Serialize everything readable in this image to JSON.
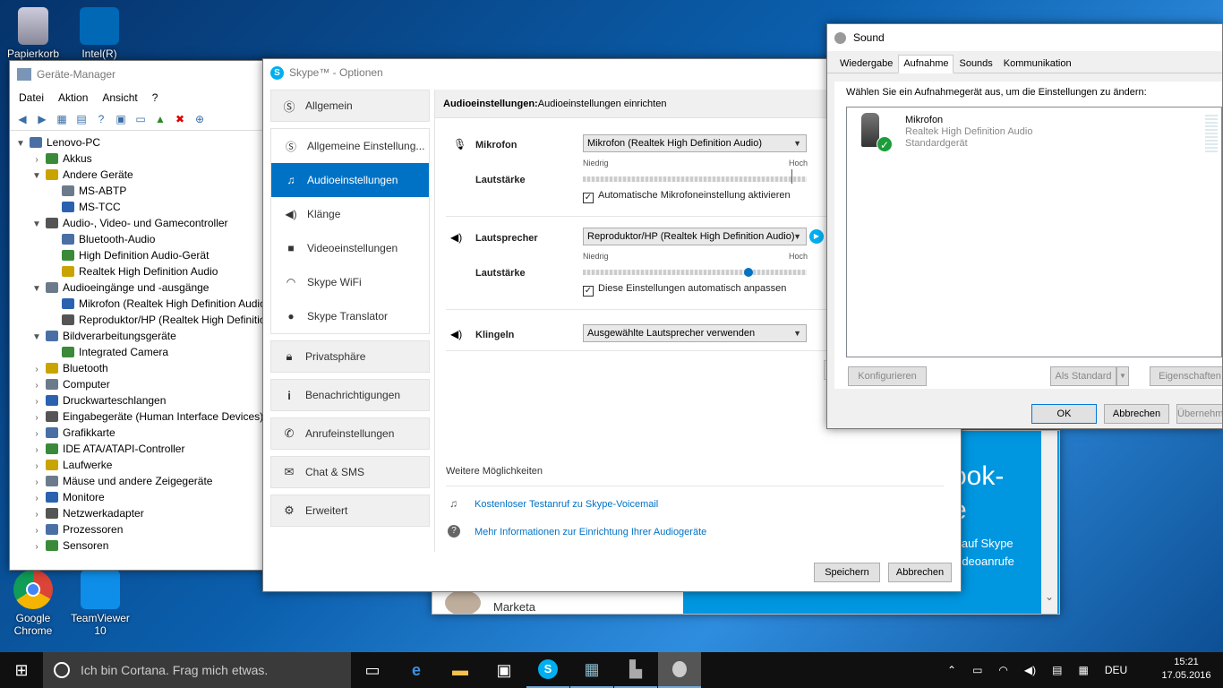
{
  "desktop": {
    "icons": [
      {
        "label": "Papierkorb"
      },
      {
        "label": "Intel(R)"
      },
      {
        "label": "Google Chrome"
      },
      {
        "label": "TeamViewer 10"
      }
    ]
  },
  "device_manager": {
    "title": "Geräte-Manager",
    "menu": [
      "Datei",
      "Aktion",
      "Ansicht",
      "?"
    ],
    "tree": [
      {
        "label": "Lenovo-PC",
        "level": 0,
        "exp": "▼"
      },
      {
        "label": "Akkus",
        "level": 1,
        "exp": "›"
      },
      {
        "label": "Andere Geräte",
        "level": 1,
        "exp": "▼"
      },
      {
        "label": "MS-ABTP",
        "level": 2,
        "exp": ""
      },
      {
        "label": "MS-TCC",
        "level": 2,
        "exp": ""
      },
      {
        "label": "Audio-, Video- und Gamecontroller",
        "level": 1,
        "exp": "▼"
      },
      {
        "label": "Bluetooth-Audio",
        "level": 2,
        "exp": ""
      },
      {
        "label": "High Definition Audio-Gerät",
        "level": 2,
        "exp": ""
      },
      {
        "label": "Realtek High Definition Audio",
        "level": 2,
        "exp": ""
      },
      {
        "label": "Audioeingänge und -ausgänge",
        "level": 1,
        "exp": "▼"
      },
      {
        "label": "Mikrofon (Realtek High Definition Audio)",
        "level": 2,
        "exp": ""
      },
      {
        "label": "Reproduktor/HP (Realtek High Definition Audio)",
        "level": 2,
        "exp": ""
      },
      {
        "label": "Bildverarbeitungsgeräte",
        "level": 1,
        "exp": "▼"
      },
      {
        "label": "Integrated Camera",
        "level": 2,
        "exp": ""
      },
      {
        "label": "Bluetooth",
        "level": 1,
        "exp": "›"
      },
      {
        "label": "Computer",
        "level": 1,
        "exp": "›"
      },
      {
        "label": "Druckwarteschlangen",
        "level": 1,
        "exp": "›"
      },
      {
        "label": "Eingabegeräte (Human Interface Devices)",
        "level": 1,
        "exp": "›"
      },
      {
        "label": "Grafikkarte",
        "level": 1,
        "exp": "›"
      },
      {
        "label": "IDE ATA/ATAPI-Controller",
        "level": 1,
        "exp": "›"
      },
      {
        "label": "Laufwerke",
        "level": 1,
        "exp": "›"
      },
      {
        "label": "Mäuse und andere Zeigegeräte",
        "level": 1,
        "exp": "›"
      },
      {
        "label": "Monitore",
        "level": 1,
        "exp": "›"
      },
      {
        "label": "Netzwerkadapter",
        "level": 1,
        "exp": "›"
      },
      {
        "label": "Prozessoren",
        "level": 1,
        "exp": "›"
      },
      {
        "label": "Sensoren",
        "level": 1,
        "exp": "›"
      }
    ]
  },
  "skype": {
    "title": "Skype™ - Optionen",
    "nav": {
      "allgemein": "Allgemein",
      "sub": [
        "Allgemeine Einstellung...",
        "Audioeinstellungen",
        "Klänge",
        "Videoeinstellungen",
        "Skype WiFi",
        "Skype Translator"
      ],
      "privatsphaere": "Privatsphäre",
      "benachrichtigungen": "Benachrichtigungen",
      "anrufeinstellungen": "Anrufeinstellungen",
      "chat": "Chat & SMS",
      "erweitert": "Erweitert"
    },
    "header_bold": "Audioeinstellungen:",
    "header_text": " Audioeinstellungen einrichten",
    "mic": {
      "label": "Mikrofon",
      "device": "Mikrofon (Realtek High Definition Audio)",
      "volume_label": "Lautstärke",
      "low": "Niedrig",
      "high": "Hoch",
      "auto_label": "Automatische Mikrofoneinstellung aktivieren"
    },
    "speaker": {
      "label": "Lautsprecher",
      "device": "Reproduktor/HP (Realtek High Definition Audio)",
      "volume_label": "Lautstärke",
      "low": "Niedrig",
      "high": "Hoch",
      "volume": 0.74,
      "auto_label": "Diese Einstellungen automatisch anpassen"
    },
    "ring": {
      "label": "Klingeln",
      "device": "Ausgewählte Lautsprecher verwenden"
    },
    "more_title": "Weitere Möglichkeiten",
    "link1": "Kostenloser Testanruf zu Skype-Voicemail",
    "link2": "Mehr Informationen zur Einrichtung Ihrer Audiogeräte",
    "save": "Speichern",
    "cancel": "Abbrechen"
  },
  "sound": {
    "title": "Sound",
    "tabs": [
      "Wiedergabe",
      "Aufnahme",
      "Sounds",
      "Kommunikation"
    ],
    "instruction": "Wählen Sie ein Aufnahmegerät aus, um die Einstellungen zu ändern:",
    "device_name": "Mikrofon",
    "device_sub": "Realtek High Definition Audio",
    "device_status": "Standardgerät",
    "configure": "Konfigurieren",
    "as_default": "Als Standard",
    "properties": "Eigenschaften",
    "ok": "OK",
    "cancel": "Abbrechen",
    "apply": "Übernehmen"
  },
  "behind": {
    "contact": "Marketa",
    "promo1": "ook-",
    "promo2": "e",
    "promo3": "e auf Skype",
    "promo4": "Videoanrufe"
  },
  "taskbar": {
    "cortana": "Ich bin Cortana. Frag mich etwas.",
    "lang": "DEU",
    "time": "15:21",
    "date": "17.05.2016"
  }
}
